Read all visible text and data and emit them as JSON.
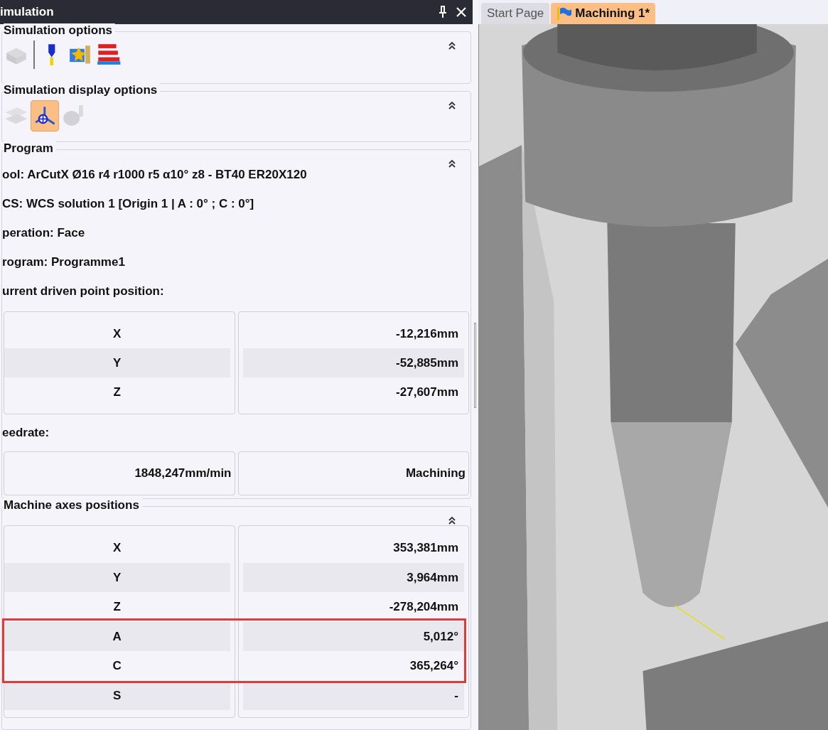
{
  "panel": {
    "title": "imulation"
  },
  "simulation_options": {
    "title": "Simulation options",
    "tools": [
      {
        "disabled": true
      },
      {
        "disabled": false
      },
      {
        "disabled": false
      },
      {
        "disabled": false
      }
    ]
  },
  "display_options": {
    "title": "Simulation display options",
    "tools": [
      {
        "disabled": true,
        "selected": false
      },
      {
        "disabled": false,
        "selected": true
      },
      {
        "disabled": true,
        "selected": false
      }
    ]
  },
  "program": {
    "title": "Program",
    "lines": [
      "ool: ArCutX Ø16 r4 r1000 r5 α10° z8 - BT40 ER20X120",
      "CS: WCS solution 1 [Origin 1 | A : 0° ; C : 0°]",
      "peration: Face",
      "rogram: Programme1",
      "urrent driven point position:"
    ],
    "driven_point": [
      {
        "axis": "X",
        "value": "-12,216mm"
      },
      {
        "axis": "Y",
        "value": "-52,885mm"
      },
      {
        "axis": "Z",
        "value": "-27,607mm"
      }
    ],
    "feedrate_label": "eedrate:",
    "feedrate": "1848,247mm/min",
    "mode": "Machining"
  },
  "machine_axes": {
    "title": "Machine axes positions",
    "rows": [
      {
        "axis": "X",
        "value": "353,381mm",
        "highlighted": false
      },
      {
        "axis": "Y",
        "value": "3,964mm",
        "highlighted": false
      },
      {
        "axis": "Z",
        "value": "-278,204mm",
        "highlighted": false
      },
      {
        "axis": "A",
        "value": "5,012°",
        "highlighted": true
      },
      {
        "axis": "C",
        "value": "365,264°",
        "highlighted": true
      },
      {
        "axis": "S",
        "value": "-",
        "highlighted": false
      }
    ]
  },
  "tabs": [
    {
      "label": "Start Page",
      "selected": false
    },
    {
      "label": "Machining 1*",
      "selected": true
    }
  ]
}
